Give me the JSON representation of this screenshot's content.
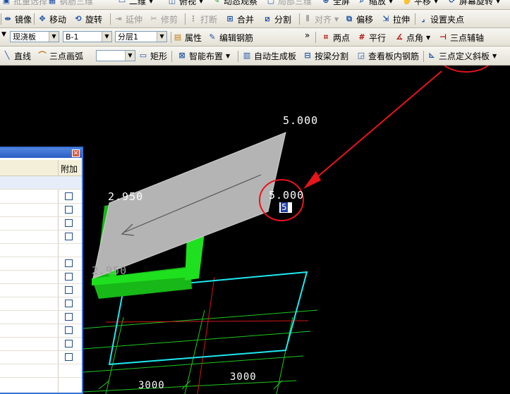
{
  "toolbar1": {
    "batch_select": "批量选择",
    "rebar_3d": "钢筋三维",
    "view_2d": "二维",
    "view_top": "俯视",
    "dynamic_observe": "动态观察",
    "local_3d": "局部三维",
    "fullscreen": "全屏",
    "zoom": "缩放",
    "pan": "平移",
    "screen_rotate": "屏幕旋转"
  },
  "toolbar2": {
    "mirror": "镜像",
    "move": "移动",
    "rotate": "旋转",
    "extend": "延伸",
    "trim": "修剪",
    "break": "打断",
    "merge": "合并",
    "split": "分割",
    "align": "对齐",
    "offset": "偏移",
    "stretch": "拉伸",
    "set_grip": "设置夹点"
  },
  "toolbar3": {
    "type_value": "现浇板",
    "name_value": "B-1",
    "layer_value": "分层1",
    "properties": "属性",
    "edit_rebar": "编辑钢筋",
    "more": "»",
    "two_point": "两点",
    "parallel": "平行",
    "point_angle": "点角",
    "three_point_axis": "三点辅轴"
  },
  "toolbar4": {
    "line": "直线",
    "three_point_arc": "三点画弧",
    "rectangle": "矩形",
    "smart_layout": "智能布置",
    "auto_gen_slab": "自动生成板",
    "split_by_beam": "按梁分割",
    "view_slab_rebar": "查看板内钢筋",
    "three_point_slope": "三点定义斜板"
  },
  "panel": {
    "column_header": "附加",
    "rows": 14
  },
  "canvas": {
    "label_top": "5.000",
    "label_right": "5.000",
    "label_left": "2.950",
    "label_bottom": "2.950",
    "input_value": "5",
    "dim_left": "3000",
    "dim_right": "3000"
  },
  "colors": {
    "slab": "#b4b4b4",
    "beam": "#1fe01f",
    "grid_cyan": "#1ee9f0",
    "grid_red": "#d11818",
    "grid_green": "#1fc81f",
    "annotation": "#e8141a"
  }
}
